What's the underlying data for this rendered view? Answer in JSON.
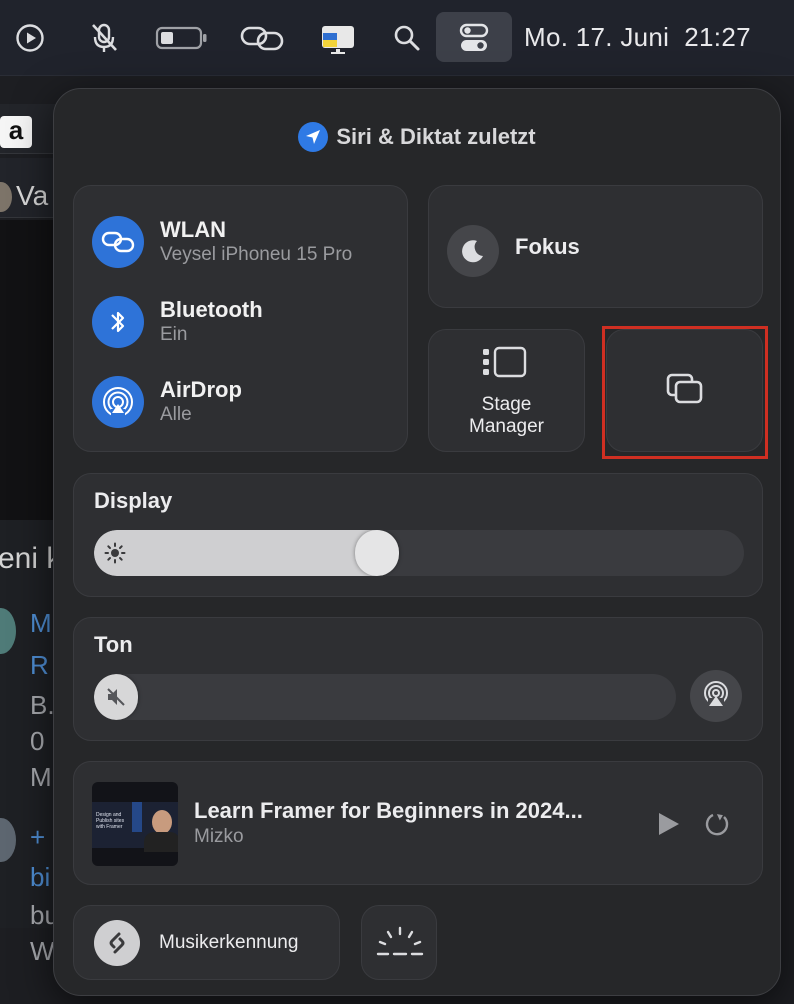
{
  "menubar": {
    "clock": "Mo. 17. Juni  21:27",
    "icons": [
      "play-circle-icon",
      "mic-muted-icon",
      "battery-icon",
      "link-icon",
      "keyboard-layout-icon",
      "search-icon",
      "control-center-icon"
    ]
  },
  "background": {
    "amazon_letter": "a",
    "text_va": "Va",
    "text_eni": "eni k",
    "text_m": "M",
    "text_r": "R",
    "text_b": "B.",
    "text_0": "0",
    "text_m2": "M",
    "text_plus": "+",
    "text_bi": "bi",
    "text_bu": "bu",
    "text_w": "W"
  },
  "panel": {
    "header": "Siri & Diktat zuletzt",
    "connectivity": [
      {
        "title": "WLAN",
        "subtitle": "Veysel iPhoneu 15 Pro",
        "icon": "wifi-link-icon"
      },
      {
        "title": "Bluetooth",
        "subtitle": "Ein",
        "icon": "bluetooth-icon"
      },
      {
        "title": "AirDrop",
        "subtitle": "Alle",
        "icon": "airdrop-icon"
      }
    ],
    "focus": {
      "label": "Fokus",
      "icon": "moon-icon"
    },
    "stage_manager": {
      "line1": "Stage",
      "line2": "Manager"
    },
    "screen_mirroring": {
      "icon": "screen-mirroring-icon"
    },
    "display": {
      "label": "Display",
      "level": 0.43
    },
    "sound": {
      "label": "Ton",
      "level": 0.0
    },
    "now_playing": {
      "title": "Learn Framer for Beginners in 2024...",
      "artist": "Mizko",
      "thumb_caption": "Design and Publish sites with Framer"
    },
    "music_recognition": {
      "label": "Musikerkennung"
    }
  },
  "colors": {
    "accent": "#2e73d8",
    "highlight": "#cf2f22",
    "tile": "#2e2f32"
  }
}
